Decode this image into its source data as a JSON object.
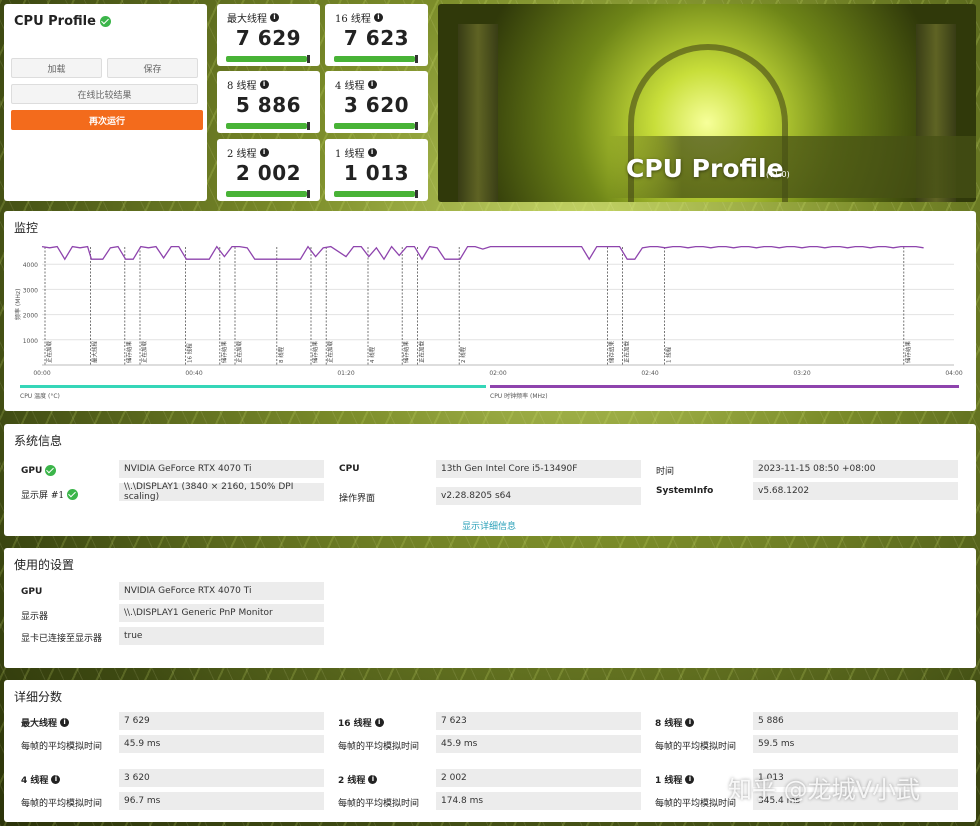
{
  "app": {
    "title": "CPU Profile",
    "buttons": {
      "load": "加载",
      "save": "保存",
      "compare": "在线比较结果",
      "rerun": "再次运行"
    }
  },
  "scores": [
    {
      "label": "最大线程",
      "value": "7 629"
    },
    {
      "label": "16 线程",
      "value": "7 623"
    },
    {
      "label": "8 线程",
      "value": "5 886"
    },
    {
      "label": "4 线程",
      "value": "3 620"
    },
    {
      "label": "2 线程",
      "value": "2 002"
    },
    {
      "label": "1 线程",
      "value": "1 013"
    }
  ],
  "hero": {
    "title": "CPU Profile",
    "version": "(v1.0)"
  },
  "monitor": {
    "title": "监控",
    "ylabel": "频率 (MHz)",
    "legend_temp": "CPU 温度 (°C)",
    "legend_clock": "CPU 时钟频率 (MHz)",
    "temp_color": "#35d6b8",
    "clock_color": "#8e44ad",
    "markers": [
      "正在加载",
      "最大线程",
      "储存结果",
      "正在加载",
      "16 线程",
      "储存结果",
      "正在加载",
      "8 线程",
      "储存结果",
      "正在加载",
      "4 线程",
      "储存结果",
      "正在加载",
      "2 线程",
      "储存结果",
      "正在加载",
      "1 线程",
      "储存结果"
    ]
  },
  "chart_data": {
    "type": "line",
    "title": "",
    "ylabel": "频率 (MHz)",
    "ylim": [
      0,
      5000
    ],
    "yticks": [
      1000,
      2000,
      3000,
      4000
    ],
    "xticks": [
      "00:00",
      "00:40",
      "01:20",
      "02:00",
      "02:40",
      "03:20",
      "04:00"
    ],
    "xlim_seconds": [
      0,
      240
    ],
    "series": [
      {
        "name": "CPU 时钟频率 (MHz)",
        "x": [
          0,
          2,
          4,
          6,
          8,
          10,
          12,
          13,
          14,
          16,
          18,
          20,
          22,
          24,
          26,
          28,
          30,
          32,
          34,
          36,
          38,
          40,
          42,
          44,
          46,
          48,
          50,
          52,
          54,
          56,
          58,
          60,
          62,
          64,
          66,
          68,
          70,
          72,
          74,
          76,
          78,
          80,
          82,
          84,
          86,
          88,
          90,
          92,
          94,
          96,
          98,
          100,
          102,
          104,
          106,
          108,
          110,
          112,
          114,
          116,
          118,
          120,
          122,
          124,
          126,
          128,
          130,
          132,
          134,
          136,
          138,
          140,
          142,
          144,
          146,
          148,
          150,
          152,
          154,
          156,
          158,
          160,
          162,
          164,
          166,
          168,
          170,
          172,
          174,
          176,
          178,
          180,
          182,
          184,
          186,
          188,
          190,
          192,
          194,
          196,
          198,
          200,
          202,
          204,
          206,
          208,
          210,
          212,
          214,
          216,
          218,
          220,
          222,
          224,
          226,
          228,
          230,
          232
        ],
        "y": [
          4700,
          4650,
          4700,
          4200,
          4700,
          4650,
          4700,
          4200,
          4200,
          4200,
          4650,
          4700,
          4200,
          4200,
          4700,
          4650,
          4700,
          4250,
          4700,
          4700,
          4200,
          4200,
          4200,
          4200,
          4700,
          4300,
          4700,
          4700,
          4650,
          4200,
          4200,
          4200,
          4200,
          4200,
          4200,
          4200,
          4700,
          4300,
          4650,
          4700,
          4500,
          4300,
          4700,
          4700,
          4300,
          4650,
          4200,
          4700,
          4350,
          4700,
          4700,
          4200,
          4700,
          4650,
          4200,
          4200,
          4200,
          4700,
          4700,
          4600,
          4700,
          4700,
          4700,
          4700,
          4700,
          4700,
          4700,
          4700,
          4700,
          4700,
          4700,
          4700,
          4700,
          4200,
          4700,
          4700,
          4700,
          4700,
          4200,
          4200,
          4650,
          4700,
          4700,
          4650,
          4700,
          4700,
          4650,
          4700,
          4700,
          4650,
          4700,
          4700,
          4650,
          4700,
          4700,
          4650,
          4700,
          4700,
          4650,
          4700,
          4700,
          4650,
          4700,
          4700,
          4650,
          4700,
          4700,
          4650,
          4700,
          4700,
          4650,
          4700,
          4700,
          4650,
          4700,
          4700,
          4700,
          4650
        ]
      }
    ],
    "marker_times": [
      0,
      12,
      21,
      25,
      37,
      46,
      50,
      61,
      70,
      74,
      85,
      94,
      98,
      109,
      148,
      152,
      163,
      226
    ]
  },
  "sysinfo": {
    "title": "系统信息",
    "rows": [
      {
        "k1": "GPU",
        "v1": "NVIDIA GeForce RTX 4070 Ti",
        "k2": "CPU",
        "v2": "13th Gen Intel Core i5-13490F",
        "k3": "时间",
        "v3": "2023-11-15 08:50 +08:00"
      },
      {
        "k1": "显示屏 #1",
        "v1": "\\\\.\\DISPLAY1 (3840 × 2160, 150% DPI scaling)",
        "k2": "操作界面",
        "v2": "v2.28.8205 s64",
        "k3": "SystemInfo",
        "v3": "v5.68.1202"
      }
    ],
    "more": "显示详细信息"
  },
  "settings": {
    "title": "使用的设置",
    "rows": [
      {
        "k": "GPU",
        "v": "NVIDIA GeForce RTX 4070 Ti"
      },
      {
        "k": "显示器",
        "v": "\\\\.\\DISPLAY1 Generic PnP Monitor"
      },
      {
        "k": "显卡已连接至显示器",
        "v": "true"
      }
    ]
  },
  "details": {
    "title": "详细分数",
    "frame_label": "每帧的平均模拟时间",
    "items": [
      {
        "label": "最大线程",
        "score": "7 629",
        "frame": "45.9 ms"
      },
      {
        "label": "16 线程",
        "score": "7 623",
        "frame": "45.9 ms"
      },
      {
        "label": "8 线程",
        "score": "5 886",
        "frame": "59.5 ms"
      },
      {
        "label": "4 线程",
        "score": "3 620",
        "frame": "96.7 ms"
      },
      {
        "label": "2 线程",
        "score": "2 002",
        "frame": "174.8 ms"
      },
      {
        "label": "1 线程",
        "score": "1 013",
        "frame": "345.4 ms"
      }
    ]
  },
  "watermark": "知乎 @龙城V小武"
}
